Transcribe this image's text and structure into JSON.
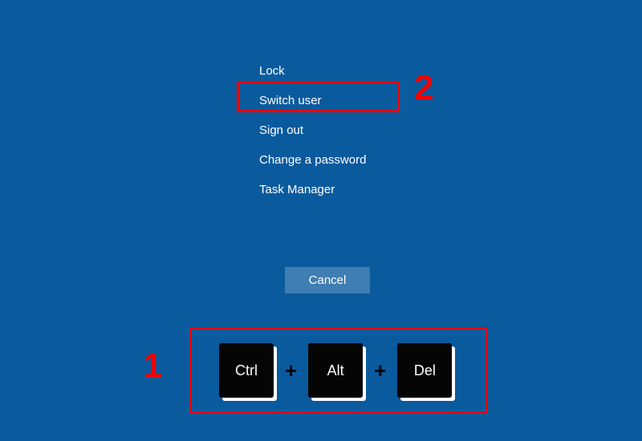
{
  "menu": {
    "items": [
      {
        "label": "Lock"
      },
      {
        "label": "Switch user"
      },
      {
        "label": "Sign out"
      },
      {
        "label": "Change a password"
      },
      {
        "label": "Task Manager"
      }
    ],
    "cancel_label": "Cancel"
  },
  "keys": {
    "k0": "Ctrl",
    "k1": "Alt",
    "k2": "Del",
    "sep": "+"
  },
  "annotations": {
    "num1": "1",
    "num2": "2"
  },
  "colors": {
    "background": "#0a5a9e",
    "annotation": "#f00000",
    "text": "#ffffff",
    "key_bg": "#050505"
  }
}
